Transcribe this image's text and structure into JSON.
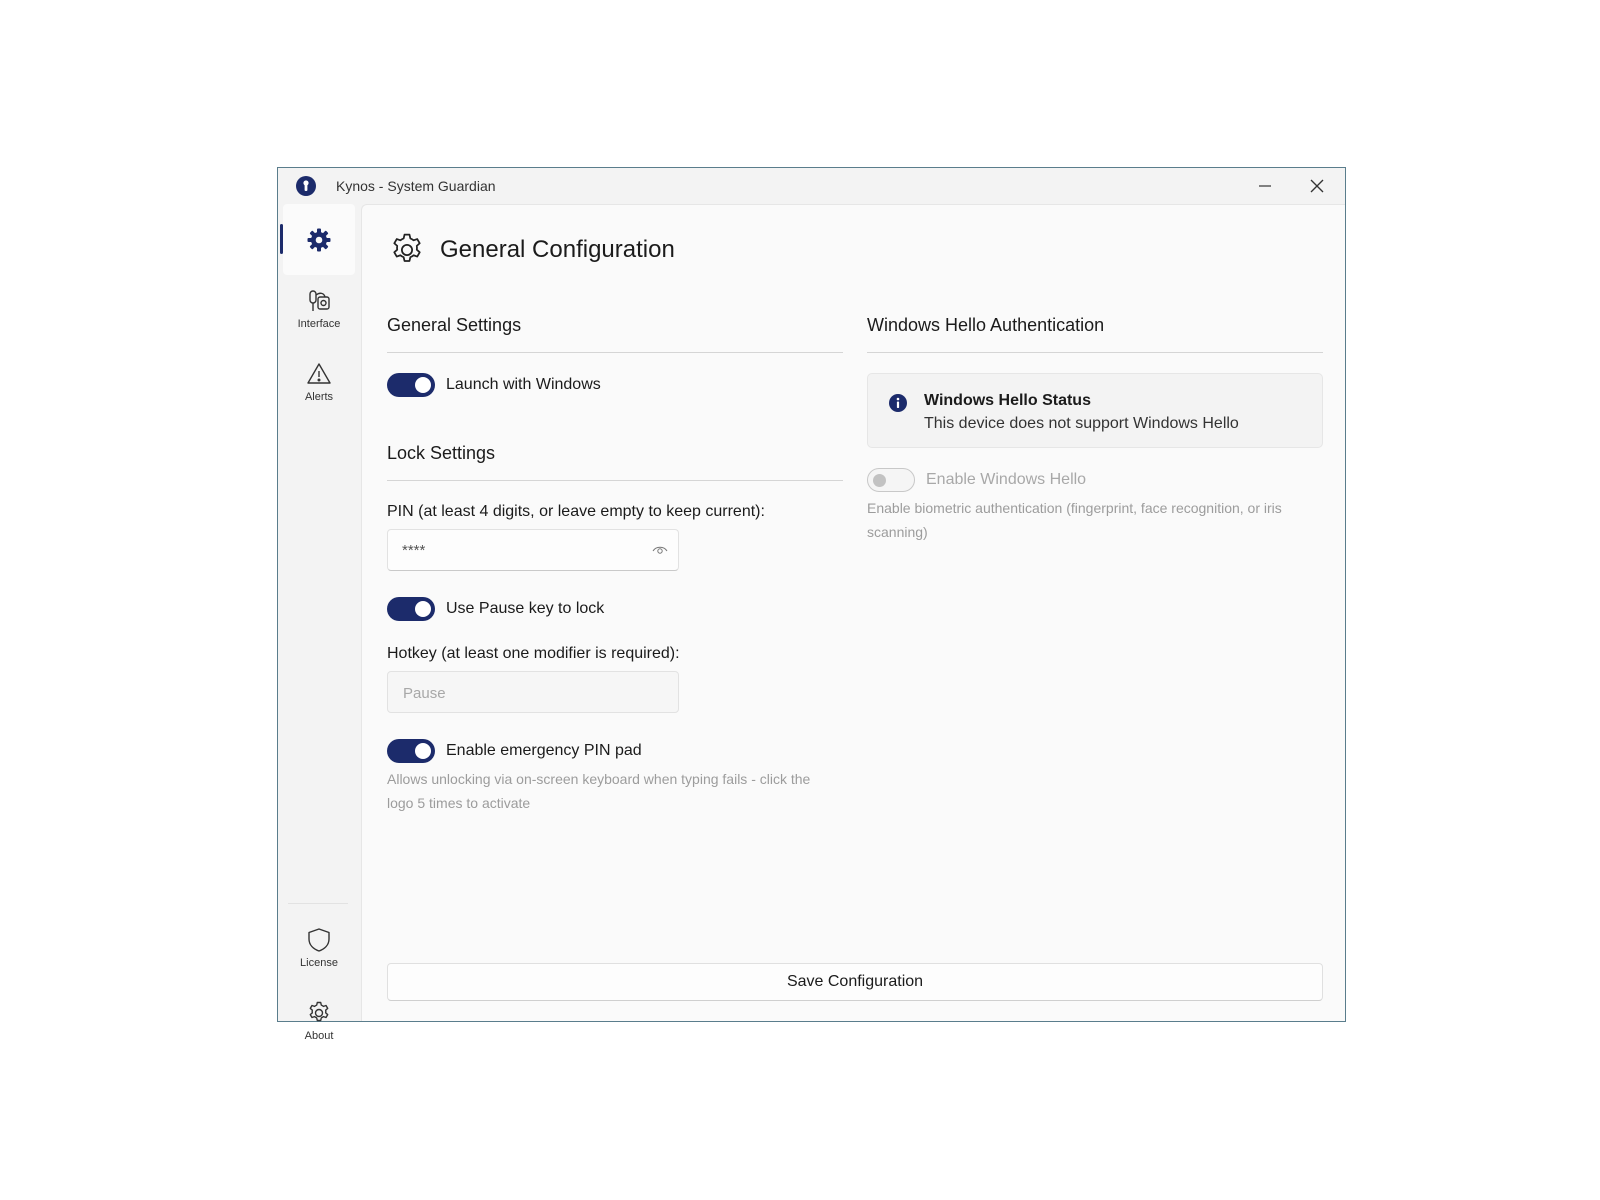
{
  "window": {
    "title": "Kynos - System Guardian",
    "minimize_icon": "minimize-icon",
    "close_icon": "close-icon"
  },
  "sidebar": {
    "items": [
      {
        "id": "general",
        "label": "",
        "icon": "gear-icon",
        "active": true
      },
      {
        "id": "interface",
        "label": "Interface",
        "icon": "interface-icon"
      },
      {
        "id": "alerts",
        "label": "Alerts",
        "icon": "warning-triangle-icon"
      }
    ],
    "footer_items": [
      {
        "id": "license",
        "label": "License",
        "icon": "shield-icon"
      },
      {
        "id": "about",
        "label": "About",
        "icon": "gear-outline-icon"
      }
    ]
  },
  "page": {
    "title": "General Configuration",
    "icon": "gear-outline-icon"
  },
  "general_settings": {
    "title": "General Settings",
    "launch_with_windows": {
      "label": "Launch with Windows",
      "on": true
    }
  },
  "lock_settings": {
    "title": "Lock Settings",
    "pin": {
      "label": "PIN (at least 4 digits, or leave empty to keep current):",
      "value": "****",
      "eye_icon": "eye-icon"
    },
    "pause_key": {
      "label": "Use Pause key to lock",
      "on": true
    },
    "hotkey": {
      "label": "Hotkey (at least one modifier is required):",
      "value": "Pause",
      "disabled": true
    },
    "emergency_pad": {
      "label": "Enable emergency PIN pad",
      "on": true,
      "hint": "Allows unlocking via on-screen keyboard when typing fails - click the logo 5 times to activate"
    }
  },
  "windows_hello": {
    "title": "Windows Hello Authentication",
    "status_title": "Windows Hello Status",
    "status_text": "This device does not support Windows Hello",
    "status_icon": "info-icon",
    "enable": {
      "label": "Enable Windows Hello",
      "on": false,
      "disabled": true
    },
    "hint": "Enable biometric authentication (fingerprint, face recognition, or iris scanning)"
  },
  "save_button": {
    "label": "Save Configuration"
  },
  "colors": {
    "accent": "#1c2b6b",
    "disabled_text": "#a8a8a8"
  }
}
